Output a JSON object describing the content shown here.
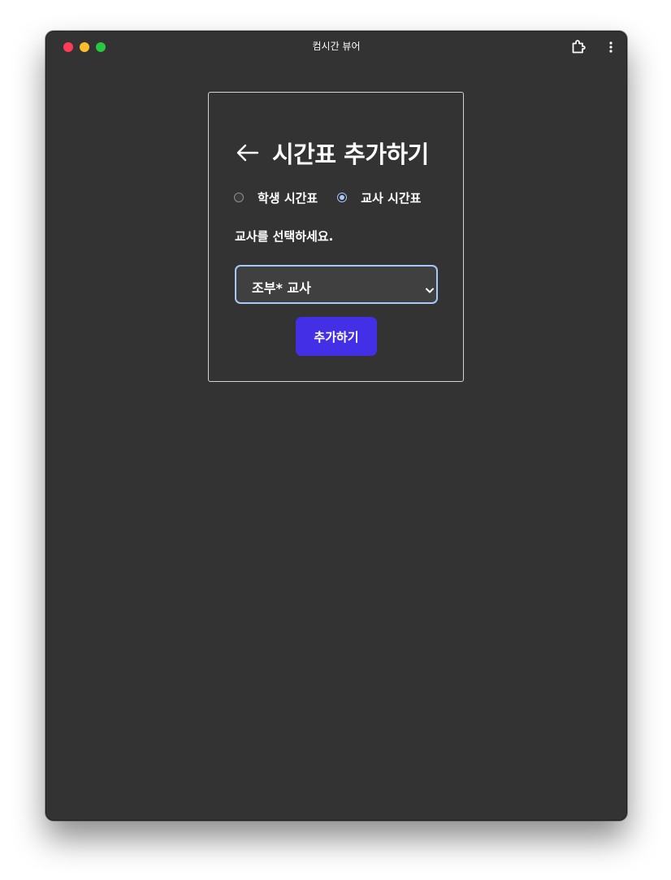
{
  "window": {
    "title": "컴시간 뷰어",
    "controls": [
      "close",
      "minimize",
      "zoom"
    ],
    "toolbar_icons": [
      "extension-puzzle-icon",
      "more-vertical-icon"
    ]
  },
  "form": {
    "heading": "시간표 추가하기",
    "back_icon": "arrow-left-icon",
    "radio_options": [
      {
        "label": "학생 시간표",
        "checked": false
      },
      {
        "label": "교사 시간표",
        "checked": true
      }
    ],
    "prompt": "교사를 선택하세요.",
    "select": {
      "selected_value": "조부* 교사"
    },
    "submit_label": "추가하기"
  },
  "colors": {
    "window_bg": "#333333",
    "accent_button": "#4330e6",
    "focus_ring": "#a8c7fa",
    "close": "#ff3b57",
    "minimize": "#febc2e",
    "zoom": "#28c840"
  }
}
